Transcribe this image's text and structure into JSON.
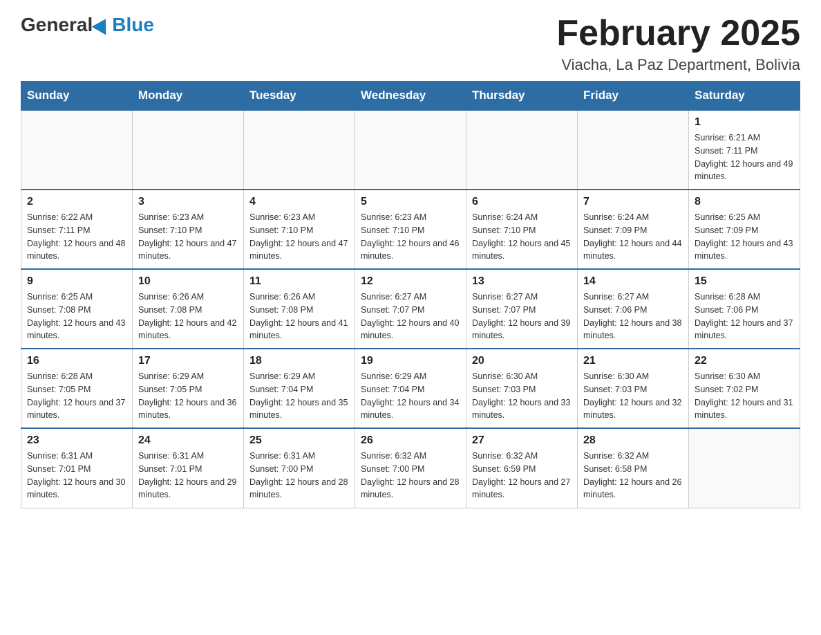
{
  "header": {
    "logo": {
      "general": "General",
      "blue": "Blue"
    },
    "title": "February 2025",
    "location": "Viacha, La Paz Department, Bolivia"
  },
  "days_of_week": [
    "Sunday",
    "Monday",
    "Tuesday",
    "Wednesday",
    "Thursday",
    "Friday",
    "Saturday"
  ],
  "weeks": [
    [
      {
        "day": "",
        "sunrise": "",
        "sunset": "",
        "daylight": ""
      },
      {
        "day": "",
        "sunrise": "",
        "sunset": "",
        "daylight": ""
      },
      {
        "day": "",
        "sunrise": "",
        "sunset": "",
        "daylight": ""
      },
      {
        "day": "",
        "sunrise": "",
        "sunset": "",
        "daylight": ""
      },
      {
        "day": "",
        "sunrise": "",
        "sunset": "",
        "daylight": ""
      },
      {
        "day": "",
        "sunrise": "",
        "sunset": "",
        "daylight": ""
      },
      {
        "day": "1",
        "sunrise": "Sunrise: 6:21 AM",
        "sunset": "Sunset: 7:11 PM",
        "daylight": "Daylight: 12 hours and 49 minutes."
      }
    ],
    [
      {
        "day": "2",
        "sunrise": "Sunrise: 6:22 AM",
        "sunset": "Sunset: 7:11 PM",
        "daylight": "Daylight: 12 hours and 48 minutes."
      },
      {
        "day": "3",
        "sunrise": "Sunrise: 6:23 AM",
        "sunset": "Sunset: 7:10 PM",
        "daylight": "Daylight: 12 hours and 47 minutes."
      },
      {
        "day": "4",
        "sunrise": "Sunrise: 6:23 AM",
        "sunset": "Sunset: 7:10 PM",
        "daylight": "Daylight: 12 hours and 47 minutes."
      },
      {
        "day": "5",
        "sunrise": "Sunrise: 6:23 AM",
        "sunset": "Sunset: 7:10 PM",
        "daylight": "Daylight: 12 hours and 46 minutes."
      },
      {
        "day": "6",
        "sunrise": "Sunrise: 6:24 AM",
        "sunset": "Sunset: 7:10 PM",
        "daylight": "Daylight: 12 hours and 45 minutes."
      },
      {
        "day": "7",
        "sunrise": "Sunrise: 6:24 AM",
        "sunset": "Sunset: 7:09 PM",
        "daylight": "Daylight: 12 hours and 44 minutes."
      },
      {
        "day": "8",
        "sunrise": "Sunrise: 6:25 AM",
        "sunset": "Sunset: 7:09 PM",
        "daylight": "Daylight: 12 hours and 43 minutes."
      }
    ],
    [
      {
        "day": "9",
        "sunrise": "Sunrise: 6:25 AM",
        "sunset": "Sunset: 7:08 PM",
        "daylight": "Daylight: 12 hours and 43 minutes."
      },
      {
        "day": "10",
        "sunrise": "Sunrise: 6:26 AM",
        "sunset": "Sunset: 7:08 PM",
        "daylight": "Daylight: 12 hours and 42 minutes."
      },
      {
        "day": "11",
        "sunrise": "Sunrise: 6:26 AM",
        "sunset": "Sunset: 7:08 PM",
        "daylight": "Daylight: 12 hours and 41 minutes."
      },
      {
        "day": "12",
        "sunrise": "Sunrise: 6:27 AM",
        "sunset": "Sunset: 7:07 PM",
        "daylight": "Daylight: 12 hours and 40 minutes."
      },
      {
        "day": "13",
        "sunrise": "Sunrise: 6:27 AM",
        "sunset": "Sunset: 7:07 PM",
        "daylight": "Daylight: 12 hours and 39 minutes."
      },
      {
        "day": "14",
        "sunrise": "Sunrise: 6:27 AM",
        "sunset": "Sunset: 7:06 PM",
        "daylight": "Daylight: 12 hours and 38 minutes."
      },
      {
        "day": "15",
        "sunrise": "Sunrise: 6:28 AM",
        "sunset": "Sunset: 7:06 PM",
        "daylight": "Daylight: 12 hours and 37 minutes."
      }
    ],
    [
      {
        "day": "16",
        "sunrise": "Sunrise: 6:28 AM",
        "sunset": "Sunset: 7:05 PM",
        "daylight": "Daylight: 12 hours and 37 minutes."
      },
      {
        "day": "17",
        "sunrise": "Sunrise: 6:29 AM",
        "sunset": "Sunset: 7:05 PM",
        "daylight": "Daylight: 12 hours and 36 minutes."
      },
      {
        "day": "18",
        "sunrise": "Sunrise: 6:29 AM",
        "sunset": "Sunset: 7:04 PM",
        "daylight": "Daylight: 12 hours and 35 minutes."
      },
      {
        "day": "19",
        "sunrise": "Sunrise: 6:29 AM",
        "sunset": "Sunset: 7:04 PM",
        "daylight": "Daylight: 12 hours and 34 minutes."
      },
      {
        "day": "20",
        "sunrise": "Sunrise: 6:30 AM",
        "sunset": "Sunset: 7:03 PM",
        "daylight": "Daylight: 12 hours and 33 minutes."
      },
      {
        "day": "21",
        "sunrise": "Sunrise: 6:30 AM",
        "sunset": "Sunset: 7:03 PM",
        "daylight": "Daylight: 12 hours and 32 minutes."
      },
      {
        "day": "22",
        "sunrise": "Sunrise: 6:30 AM",
        "sunset": "Sunset: 7:02 PM",
        "daylight": "Daylight: 12 hours and 31 minutes."
      }
    ],
    [
      {
        "day": "23",
        "sunrise": "Sunrise: 6:31 AM",
        "sunset": "Sunset: 7:01 PM",
        "daylight": "Daylight: 12 hours and 30 minutes."
      },
      {
        "day": "24",
        "sunrise": "Sunrise: 6:31 AM",
        "sunset": "Sunset: 7:01 PM",
        "daylight": "Daylight: 12 hours and 29 minutes."
      },
      {
        "day": "25",
        "sunrise": "Sunrise: 6:31 AM",
        "sunset": "Sunset: 7:00 PM",
        "daylight": "Daylight: 12 hours and 28 minutes."
      },
      {
        "day": "26",
        "sunrise": "Sunrise: 6:32 AM",
        "sunset": "Sunset: 7:00 PM",
        "daylight": "Daylight: 12 hours and 28 minutes."
      },
      {
        "day": "27",
        "sunrise": "Sunrise: 6:32 AM",
        "sunset": "Sunset: 6:59 PM",
        "daylight": "Daylight: 12 hours and 27 minutes."
      },
      {
        "day": "28",
        "sunrise": "Sunrise: 6:32 AM",
        "sunset": "Sunset: 6:58 PM",
        "daylight": "Daylight: 12 hours and 26 minutes."
      },
      {
        "day": "",
        "sunrise": "",
        "sunset": "",
        "daylight": ""
      }
    ]
  ]
}
